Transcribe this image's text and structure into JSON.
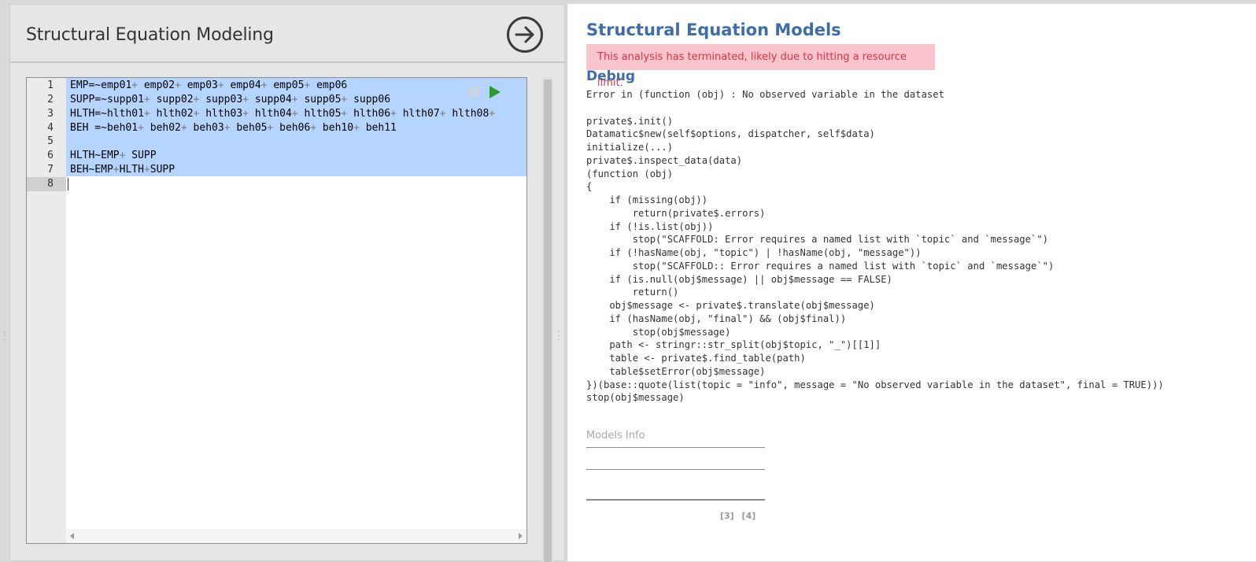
{
  "left_panel": {
    "title": "Structural Equation Modeling"
  },
  "editor": {
    "line_numbers": [
      "1",
      "2",
      "3",
      "4",
      "5",
      "6",
      "7",
      "8"
    ],
    "lines": [
      [
        {
          "t": "EMP=~emp01"
        },
        {
          "t": "+",
          "op": true
        },
        {
          "t": " emp02"
        },
        {
          "t": "+",
          "op": true
        },
        {
          "t": " emp03"
        },
        {
          "t": "+",
          "op": true
        },
        {
          "t": " emp04"
        },
        {
          "t": "+",
          "op": true
        },
        {
          "t": " emp05"
        },
        {
          "t": "+",
          "op": true
        },
        {
          "t": " emp06"
        }
      ],
      [
        {
          "t": "SUPP=~supp01"
        },
        {
          "t": "+",
          "op": true
        },
        {
          "t": " supp02"
        },
        {
          "t": "+",
          "op": true
        },
        {
          "t": " supp03"
        },
        {
          "t": "+",
          "op": true
        },
        {
          "t": " supp04"
        },
        {
          "t": "+",
          "op": true
        },
        {
          "t": " supp05"
        },
        {
          "t": "+",
          "op": true
        },
        {
          "t": " supp06"
        }
      ],
      [
        {
          "t": "HLTH=~hlth01"
        },
        {
          "t": "+",
          "op": true
        },
        {
          "t": " hlth02"
        },
        {
          "t": "+",
          "op": true
        },
        {
          "t": " hlth03"
        },
        {
          "t": "+",
          "op": true
        },
        {
          "t": " hlth04"
        },
        {
          "t": "+",
          "op": true
        },
        {
          "t": " hlth05"
        },
        {
          "t": "+",
          "op": true
        },
        {
          "t": " hlth06"
        },
        {
          "t": "+",
          "op": true
        },
        {
          "t": " hlth07"
        },
        {
          "t": "+",
          "op": true
        },
        {
          "t": " hlth08"
        },
        {
          "t": "+",
          "op": true
        }
      ],
      [
        {
          "t": "BEH =~beh01"
        },
        {
          "t": "+",
          "op": true
        },
        {
          "t": " beh02"
        },
        {
          "t": "+",
          "op": true
        },
        {
          "t": " beh03"
        },
        {
          "t": "+",
          "op": true
        },
        {
          "t": " beh05"
        },
        {
          "t": "+",
          "op": true
        },
        {
          "t": " beh06"
        },
        {
          "t": "+",
          "op": true
        },
        {
          "t": " beh10"
        },
        {
          "t": "+",
          "op": true
        },
        {
          "t": " beh11"
        }
      ],
      [],
      [
        {
          "t": "HLTH~EMP"
        },
        {
          "t": "+",
          "op": true
        },
        {
          "t": " SUPP"
        }
      ],
      [
        {
          "t": "BEH~EMP"
        },
        {
          "t": "+",
          "op": true
        },
        {
          "t": "HLTH"
        },
        {
          "t": "+",
          "op": true
        },
        {
          "t": "SUPP"
        }
      ],
      []
    ]
  },
  "results": {
    "title": "Structural Equation Models",
    "alert": "This analysis has terminated, likely due to hitting a resource limit.",
    "debug_heading": "Debug",
    "debug_text": "Error in (function (obj) : No observed variable in the dataset\n\nprivate$.init()\nDatamatic$new(self$options, dispatcher, self$data)\ninitialize(...)\nprivate$.inspect_data(data)\n(function (obj)\n{\n    if (missing(obj))\n        return(private$.errors)\n    if (!is.list(obj))\n        stop(\"SCAFFOLD: Error requires a named list with `topic` and `message`\")\n    if (!hasName(obj, \"topic\") | !hasName(obj, \"message\"))\n        stop(\"SCAFFOLD:: Error requires a named list with `topic` and `message`\")\n    if (is.null(obj$message) || obj$message == FALSE)\n        return()\n    obj$message <- private$.translate(obj$message)\n    if (hasName(obj, \"final\") && (obj$final))\n        stop(obj$message)\n    path <- stringr::str_split(obj$topic, \"_\")[[1]]\n    table <- private$.find_table(path)\n    table$setError(obj$message)\n})(base::quote(list(topic = \"info\", message = \"No observed variable in the dataset\", final = TRUE)))\nstop(obj$message)",
    "models_info_title": "Models Info",
    "footnotes": "[3] [4]"
  },
  "colors": {
    "accent": "#3e6da9",
    "alert_bg": "#f9c4cb",
    "alert_text": "#d9344a",
    "selection": "#b5d5ff",
    "run_green": "#2b9a2b"
  },
  "icons": {
    "next": "arrow-right-circle-icon",
    "options": "gear-icon",
    "run": "play-icon"
  }
}
